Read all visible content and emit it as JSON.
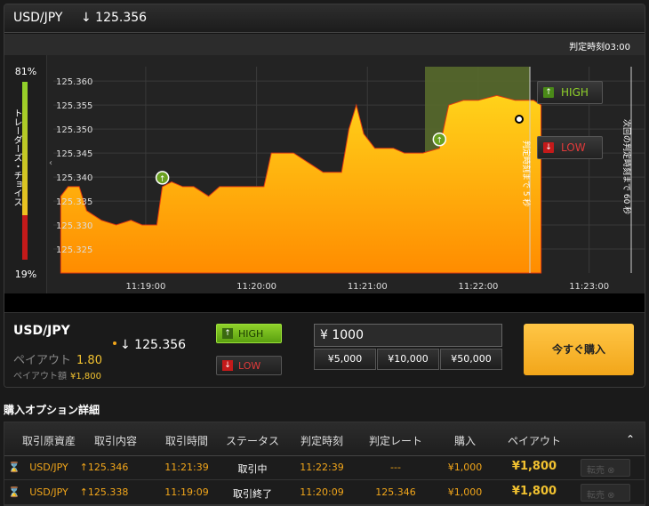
{
  "header": {
    "pair": "USD/JPY",
    "rate": "↓ 125.356"
  },
  "chart": {
    "judge_time": "判定時刻03:00",
    "gauge_high_pct": "81%",
    "gauge_low_pct": "19%",
    "gauge_label": "トレーダーズ・チョイス",
    "y_ticks": [
      "125.360",
      "125.355",
      "125.350",
      "125.345",
      "125.340",
      "125.335",
      "125.330",
      "125.325"
    ],
    "x_ticks": [
      "11:19:00",
      "11:20:00",
      "11:21:00",
      "11:22:00",
      "11:23:00"
    ],
    "judge_label": "判定時刻まで 5 秒",
    "next_judge_label": "次回の判定時刻まで 60 秒",
    "high_label": "HIGH",
    "low_label": "LOW"
  },
  "chart_data": {
    "type": "area",
    "y_range": [
      125.32,
      125.363
    ],
    "x_range_seconds": [
      "11:18:10",
      "11:23:30"
    ],
    "series": [
      {
        "values": [
          [
            "11:18:14",
            125.336
          ],
          [
            "11:18:18",
            125.338
          ],
          [
            "11:18:24",
            125.338
          ],
          [
            "11:18:28",
            125.333
          ],
          [
            "11:18:36",
            125.331
          ],
          [
            "11:18:44",
            125.33
          ],
          [
            "11:18:52",
            125.331
          ],
          [
            "11:18:58",
            125.33
          ],
          [
            "11:19:06",
            125.33
          ],
          [
            "11:19:09",
            125.338
          ],
          [
            "11:19:14",
            125.339
          ],
          [
            "11:19:20",
            125.338
          ],
          [
            "11:19:26",
            125.338
          ],
          [
            "11:19:34",
            125.336
          ],
          [
            "11:19:40",
            125.338
          ],
          [
            "11:19:48",
            125.338
          ],
          [
            "11:19:58",
            125.338
          ],
          [
            "11:20:04",
            125.338
          ],
          [
            "11:20:08",
            125.345
          ],
          [
            "11:20:20",
            125.345
          ],
          [
            "11:20:24",
            125.344
          ],
          [
            "11:20:28",
            125.343
          ],
          [
            "11:20:36",
            125.341
          ],
          [
            "11:20:46",
            125.341
          ],
          [
            "11:20:50",
            125.35
          ],
          [
            "11:20:54",
            125.355
          ],
          [
            "11:20:58",
            125.349
          ],
          [
            "11:21:04",
            125.346
          ],
          [
            "11:21:14",
            125.346
          ],
          [
            "11:21:20",
            125.345
          ],
          [
            "11:21:30",
            125.345
          ],
          [
            "11:21:39",
            125.346
          ],
          [
            "11:21:44",
            125.355
          ],
          [
            "11:21:52",
            125.356
          ],
          [
            "11:22:00",
            125.356
          ],
          [
            "11:22:10",
            125.357
          ],
          [
            "11:22:20",
            125.356
          ],
          [
            "11:22:30",
            125.356
          ],
          [
            "11:22:34",
            125.355
          ]
        ]
      }
    ]
  },
  "bottom": {
    "pair": "USD/JPY",
    "rate": "↓ 125.356",
    "payout_label": "ペイアウト",
    "payout_value": "1.80",
    "payout_amount_label": "ペイアウト額",
    "payout_amount_value": "¥1,800",
    "high_label": "HIGH",
    "low_label": "LOW",
    "amount": "¥ 1000",
    "quick": [
      "¥5,000",
      "¥10,000",
      "¥50,000"
    ],
    "buy_label": "今すぐ購入"
  },
  "details": {
    "title": "購入オプション詳細",
    "headers": [
      "取引原資産",
      "取引内容",
      "取引時間",
      "ステータス",
      "判定時刻",
      "判定レート",
      "購入",
      "ペイアウト"
    ],
    "rows": [
      {
        "asset": "USD/JPY",
        "content": "↑125.346",
        "time": "11:21:39",
        "status": "取引中",
        "judge": "11:22:39",
        "rate": "---",
        "buy": "¥1,000",
        "payout": "¥1,800",
        "sell": "転売"
      },
      {
        "asset": "USD/JPY",
        "content": "↑125.338",
        "time": "11:19:09",
        "status": "取引終了",
        "judge": "11:20:09",
        "rate": "125.346",
        "buy": "¥1,000",
        "payout": "¥1,800",
        "sell": "転売"
      }
    ]
  },
  "colors": {
    "accent": "#f2a61a",
    "high": "#8fd12a",
    "low": "#d42a2a",
    "payout": "#f2c230"
  }
}
